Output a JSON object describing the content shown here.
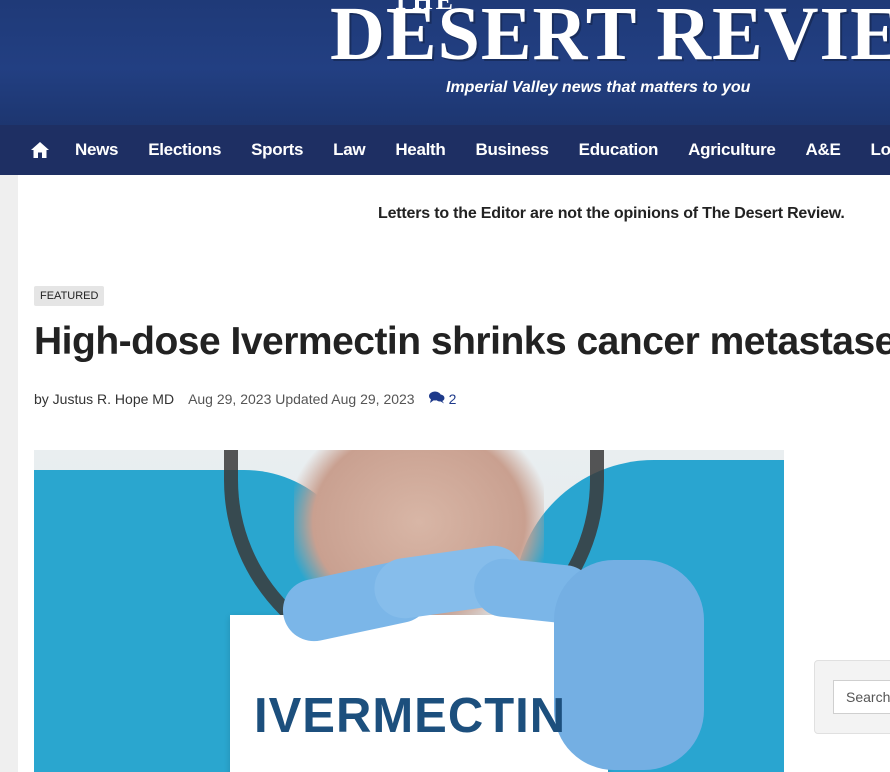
{
  "masthead": {
    "the": "THE",
    "title": "DESERT REVIEW",
    "tagline": "Imperial Valley news that matters to you"
  },
  "nav": {
    "home_icon": "home-icon",
    "items": [
      "News",
      "Elections",
      "Sports",
      "Law",
      "Health",
      "Business",
      "Education",
      "Agriculture",
      "A&E",
      "Local Ev"
    ]
  },
  "notice": "Letters to the Editor are not the opinions of The Desert Review.",
  "article": {
    "badge": "FEATURED",
    "headline": "High-dose Ivermectin shrinks cancer metastases",
    "author": "by Justus R. Hope MD",
    "dates": "Aug 29, 2023 Updated Aug 29, 2023",
    "comments_icon": "comments-icon",
    "comment_count": "2",
    "image_text": "IVERMECTIN"
  },
  "sidebar": {
    "search_placeholder": "Search"
  },
  "colors": {
    "header_blue": "#223f82",
    "nav_blue": "#1e2f63",
    "link_blue": "#1e3a8a"
  }
}
